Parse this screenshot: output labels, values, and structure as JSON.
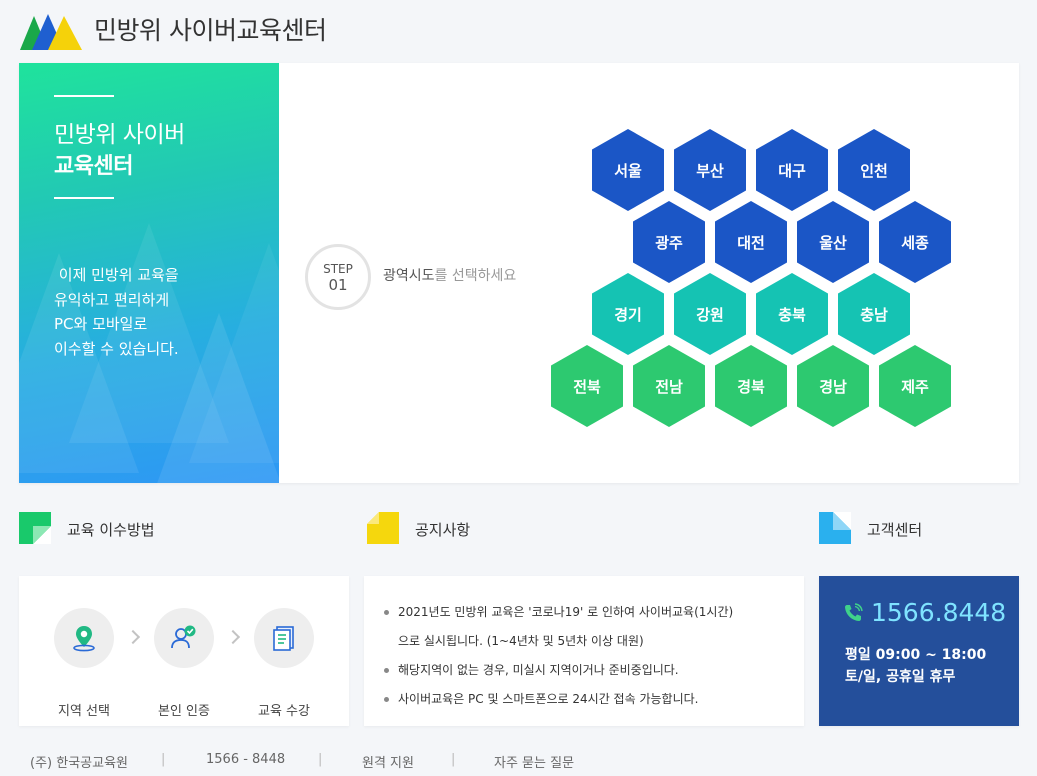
{
  "header": {
    "title": "민방위 사이버교육센터"
  },
  "hero": {
    "title_line1": "민방위 사이버",
    "title_line2": "교육센터",
    "desc": [
      " 이제 민방위 교육을",
      "유익하고 편리하게",
      "PC와 모바일로",
      "이수할 수 있습니다."
    ]
  },
  "step": {
    "label": "STEP",
    "num": "01",
    "text_strong": "광역시도",
    "text_rest": "를 선택하세요"
  },
  "regions": [
    {
      "name": "서울",
      "color": "blue"
    },
    {
      "name": "부산",
      "color": "blue"
    },
    {
      "name": "대구",
      "color": "blue"
    },
    {
      "name": "인천",
      "color": "blue"
    },
    {
      "name": "광주",
      "color": "blue"
    },
    {
      "name": "대전",
      "color": "blue"
    },
    {
      "name": "울산",
      "color": "blue"
    },
    {
      "name": "세종",
      "color": "blue"
    },
    {
      "name": "경기",
      "color": "teal"
    },
    {
      "name": "강원",
      "color": "teal"
    },
    {
      "name": "충북",
      "color": "teal"
    },
    {
      "name": "충남",
      "color": "teal"
    },
    {
      "name": "전북",
      "color": "green"
    },
    {
      "name": "전남",
      "color": "green"
    },
    {
      "name": "경북",
      "color": "green"
    },
    {
      "name": "경남",
      "color": "green"
    },
    {
      "name": "제주",
      "color": "green"
    }
  ],
  "sections": {
    "method": "교육 이수방법",
    "notice": "공지사항",
    "cs": "고객센터"
  },
  "process": [
    "지역 선택",
    "본인 인증",
    "교육 수강"
  ],
  "notices": [
    {
      "line1": "2021년도 민방위 교육은 '코로나19' 로 인하여 사이버교육(1시간)",
      "line2": "으로 실시됩니다. (1~4년차 및 5년차 이상 대원)"
    },
    {
      "line1": "해당지역이 없는 경우, 미실시 지역이거나 준비중입니다.",
      "line2": ""
    },
    {
      "line1": "사이버교육은 PC 및 스마트폰으로 24시간 접속 가능합니다.",
      "line2": ""
    }
  ],
  "cs": {
    "phone": "1566.8448",
    "weekday": "평일 09:00 ~ 18:00",
    "weekend": "토/일, 공휴일 휴무"
  },
  "footer": {
    "company": "(주) 한국공교육원",
    "phone": "1566 - 8448",
    "remote": "원격 지원",
    "faq": "자주 묻는 질문",
    "sep": "|"
  },
  "colors": {
    "blue": "#1b56c6",
    "teal": "#15c3b3",
    "green": "#2dc970",
    "cs_bg": "#244f9b"
  }
}
